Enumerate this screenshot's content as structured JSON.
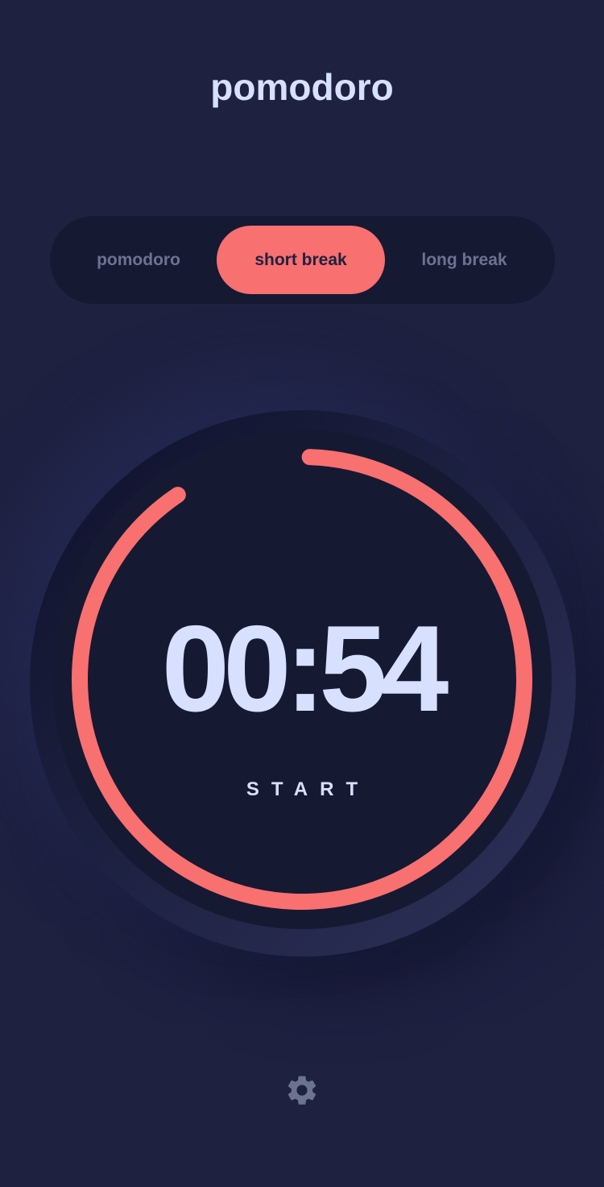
{
  "app": {
    "title": "pomodoro"
  },
  "modes": [
    {
      "label": "pomodoro",
      "active": false
    },
    {
      "label": "short break",
      "active": true
    },
    {
      "label": "long break",
      "active": false
    }
  ],
  "timer": {
    "time": "00:54",
    "action_label": "START",
    "progress_remaining": 0.9
  },
  "settings": {
    "icon": "gear-icon"
  },
  "colors": {
    "background": "#1e2140",
    "panel": "#161932",
    "accent": "#f87070",
    "text": "#d7e0ff",
    "muted": "#6c7391"
  }
}
